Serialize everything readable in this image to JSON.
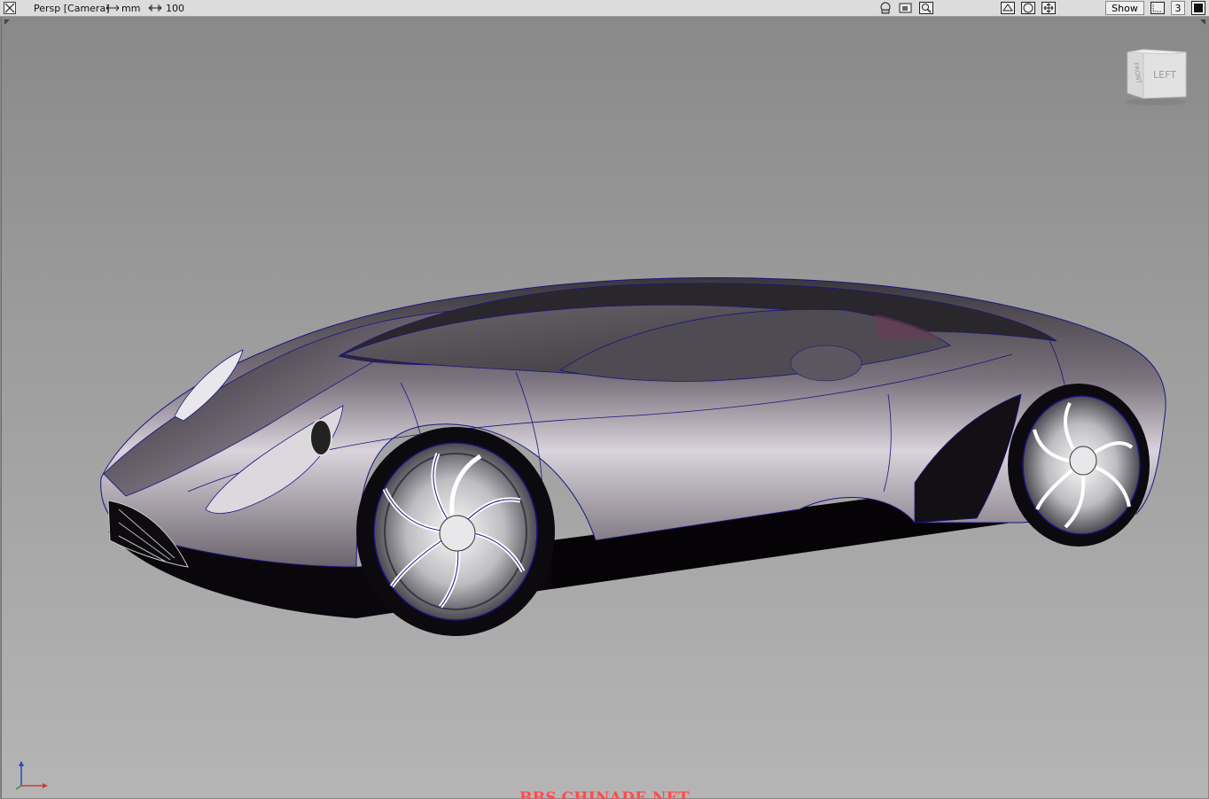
{
  "toolbar": {
    "camera_label": "Persp [Camera]",
    "units_label": "mm",
    "scale_label": "100",
    "show_label": "Show",
    "layout_number": "3"
  },
  "viewcube": {
    "face_label": "LEFT",
    "side_label": "FRONT"
  },
  "watermark": "BBS.CHINADE.NET",
  "colors": {
    "toolbar_bg": "#dcdcdc",
    "viewport_top": "#898989",
    "viewport_bottom": "#b5b5b5",
    "watermark": "#ff4b4b",
    "wire": "#1a1a8c"
  },
  "icons": [
    "close-viewport-icon",
    "units-arrow-icon",
    "scale-icon",
    "camera-tumble-icon",
    "camera-record-icon",
    "zoom-icon",
    "grid-icon",
    "shade-icon",
    "move-icon",
    "layout-icon",
    "maximize-icon",
    "axis-triad-icon"
  ]
}
